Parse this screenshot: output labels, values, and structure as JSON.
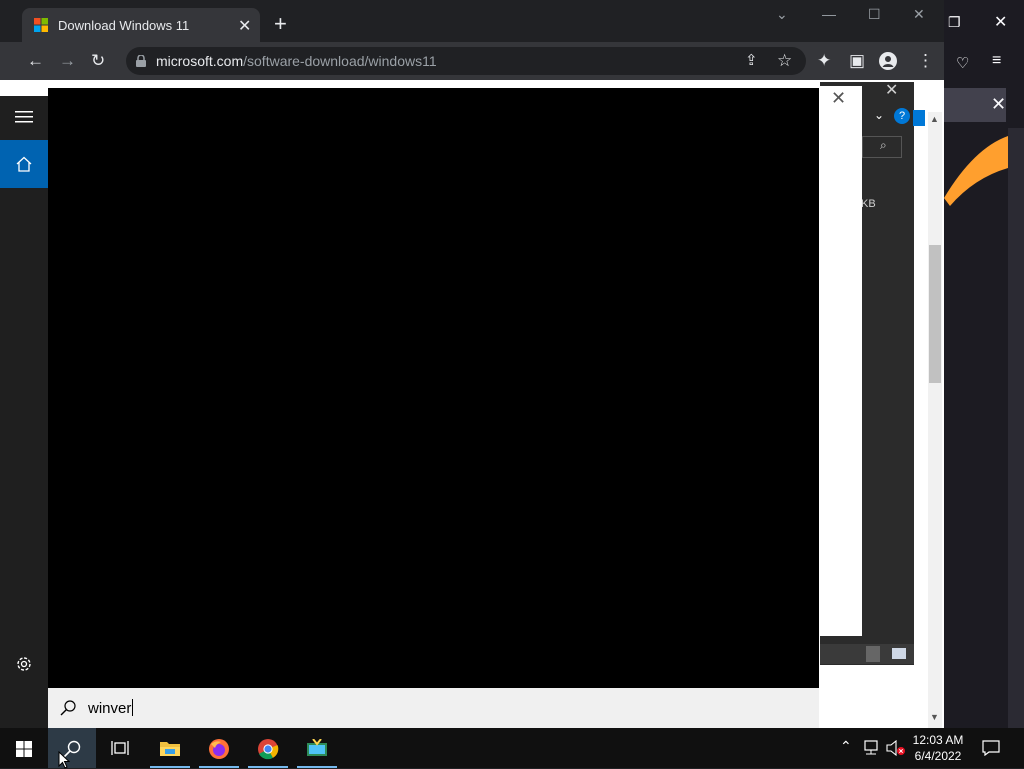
{
  "browser": {
    "tab_title": "Download Windows 11",
    "url_host": "microsoft.com",
    "url_path": "/software-download/windows11"
  },
  "dialog": {
    "kb_label": "KB",
    "help_label": "?"
  },
  "search": {
    "query": "winver"
  },
  "taskbar": {
    "time": "12:03 AM",
    "date": "6/4/2022"
  },
  "icons": [
    "windows-start-icon",
    "search-icon",
    "task-view-icon",
    "file-explorer-icon",
    "firefox-icon",
    "chrome-icon",
    "app-icon",
    "hamburger-icon",
    "home-icon",
    "gear-icon"
  ]
}
